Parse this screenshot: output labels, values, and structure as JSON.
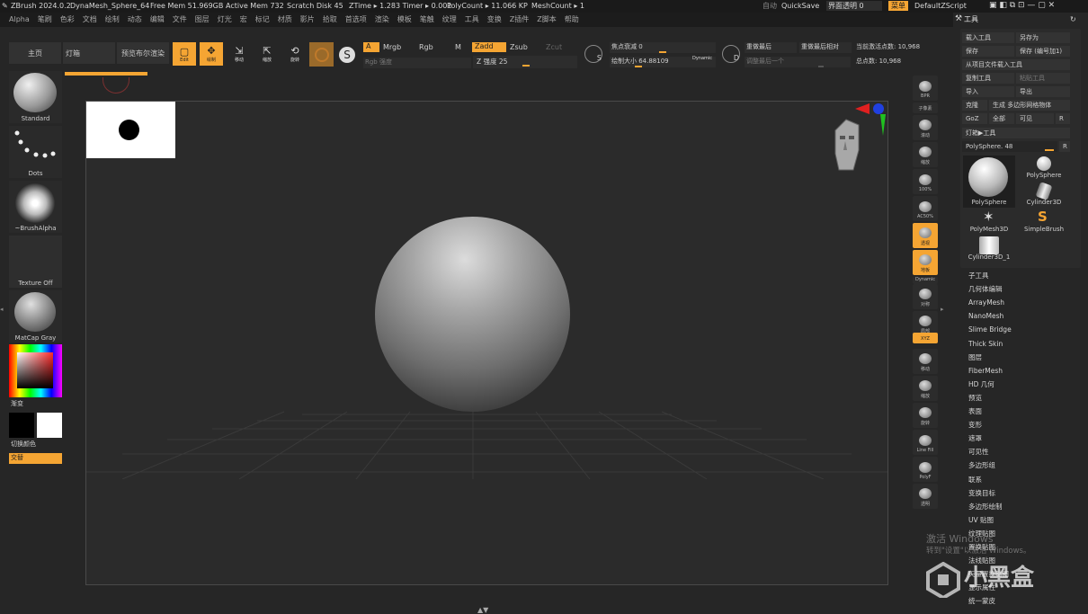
{
  "titlebar": {
    "app": "ZBrush 2024.0.2",
    "document": "DynaMesh_Sphere_64",
    "free_mem": "Free Mem 51.969GB",
    "active_mem": "Active Mem 732",
    "scratch": "Scratch Disk 45",
    "ztime": "ZTime ▸ 1.283 Timer ▸ 0.001",
    "polycount": "PolyCount ▸ 11.066 KP",
    "meshcount": "MeshCount ▸ 1",
    "auto_label": "自动",
    "quicksave": "QuickSave",
    "transparency": "界面透明 0",
    "menu_btn": "菜单",
    "zscript": "DefaultZScript"
  },
  "menus": [
    "Alpha",
    "笔刷",
    "色彩",
    "文档",
    "绘制",
    "动态",
    "编辑",
    "文件",
    "图层",
    "灯光",
    "宏",
    "标记",
    "材质",
    "影片",
    "拾取",
    "首选项",
    "渲染",
    "模板",
    "笔触",
    "纹理",
    "工具",
    "变换",
    "Z插件",
    "Z脚本",
    "帮助"
  ],
  "shelf": {
    "home": "主页",
    "lightbox": "灯箱",
    "bpr": "预览布尔渲染",
    "edit": "Edit",
    "draw": "绘制",
    "move": "移动",
    "scale": "缩放",
    "rotate": "旋转",
    "a": "A",
    "mrgb": "Mrgb",
    "rgb": "Rgb",
    "m": "M",
    "rgb_intensity": "Rgb 强度",
    "zadd": "Zadd",
    "zsub": "Zsub",
    "zcut": "Zcut",
    "z_intensity": "Z 强度 25",
    "focal": "焦点衰减 0",
    "draw_size": "绘制大小 64.88109",
    "dynamic": "Dynamic",
    "replay_last": "重做最后",
    "replay_rel": "重做最后相对",
    "adjust_last": "调整最后一个",
    "active_points": "当前激活点数: 10,968",
    "total_points": "总点数: 10,968"
  },
  "left": {
    "brush": "Standard",
    "stroke": "Dots",
    "alpha": "~BrushAlpha",
    "texture": "Texture Off",
    "material": "MatCap Gray",
    "gradient": "渐变",
    "switch_color": "切换颜色",
    "swap": "交替"
  },
  "right_icons": [
    "BPR",
    "子像素",
    "滚动",
    "缩放",
    "Zoom2D",
    "100%",
    "AC50%",
    "透视",
    "地板",
    "Dynamic",
    "对称",
    "局部",
    "XYZ",
    "移动",
    "缩放",
    "旋转",
    "Line Fill",
    "PolyF",
    "透明"
  ],
  "tool_panel": {
    "title": "工具",
    "load": "载入工具",
    "save_as": "另存为",
    "save": "保存",
    "save_num": "保存 (编号加1)",
    "import_project": "从项目文件载入工具",
    "copy": "复制工具",
    "paste": "粘贴工具",
    "import": "导入",
    "export": "导出",
    "clone": "克隆",
    "make_poly": "生成 多边形网格物体",
    "goz": "GoZ",
    "all": "全部",
    "visible": "可见",
    "r": "R",
    "lightbox_tool": "灯箱▶工具",
    "polysphere_slider": "PolySphere. 48",
    "thumbs": [
      "PolySphere",
      "PolySphere",
      "Cylinder3D",
      "PolyMesh3D",
      "SimpleBrush",
      "Cylinder3D_1"
    ],
    "sections": [
      "子工具",
      "几何体编辑",
      "ArrayMesh",
      "NanoMesh",
      "Slime Bridge",
      "Thick Skin",
      "图层",
      "FiberMesh",
      "HD 几何",
      "预览",
      "表面",
      "变形",
      "遮罩",
      "可见性",
      "多边形组",
      "联系",
      "变换目标",
      "多边形绘制",
      "UV 贴图",
      "纹理贴图",
      "置换贴图",
      "法线贴图",
      "矢量置换贴图",
      "显示属性",
      "统一蒙皮"
    ]
  },
  "watermark": {
    "line1": "激活 Windows",
    "line2": "转到\"设置\"以激活 Windows。",
    "brand": "小黑盒"
  }
}
